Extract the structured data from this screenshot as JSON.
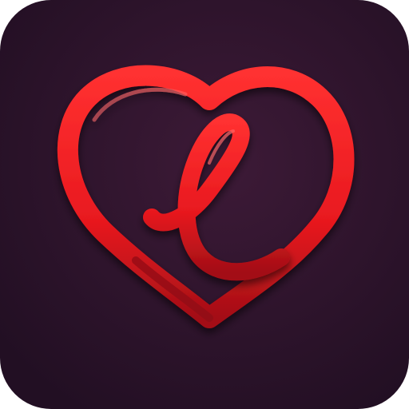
{
  "icon": {
    "name": "heart-letter-l-app-icon",
    "glyph": "heart-with-script-l",
    "colors": {
      "background_center": "#3d1a37",
      "background_edge": "#220f23",
      "heart_stroke": "#e8191f",
      "heart_stroke_dark": "#a30f17",
      "highlight": "#ff5a5a"
    }
  }
}
